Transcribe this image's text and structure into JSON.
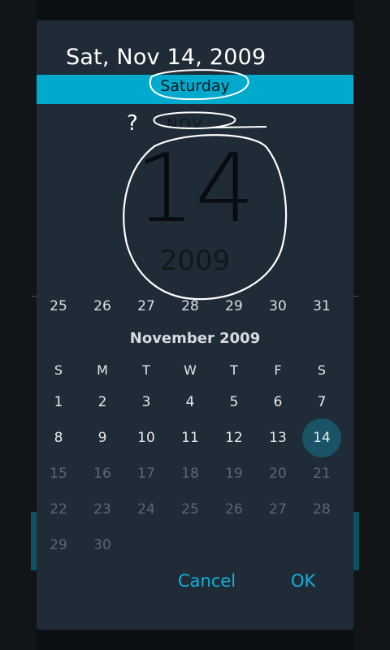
{
  "dialog": {
    "date_title": "Sat, Nov 14, 2009",
    "day_of_week": "Saturday",
    "month_short": "NOV",
    "day_number": "14",
    "year": "2009"
  },
  "calendar": {
    "previous_week": [
      "25",
      "26",
      "27",
      "28",
      "29",
      "30",
      "31"
    ],
    "month_title": "November 2009",
    "weekdays": [
      "S",
      "M",
      "T",
      "W",
      "T",
      "F",
      "S"
    ],
    "weeks": [
      [
        "1",
        "2",
        "3",
        "4",
        "5",
        "6",
        "7"
      ],
      [
        "8",
        "9",
        "10",
        "11",
        "12",
        "13",
        "14"
      ],
      [
        "15",
        "16",
        "17",
        "18",
        "19",
        "20",
        "21"
      ],
      [
        "22",
        "23",
        "24",
        "25",
        "26",
        "27",
        "28"
      ],
      [
        "29",
        "30",
        "",
        "",
        "",
        "",
        ""
      ]
    ],
    "selected_day": "14"
  },
  "buttons": {
    "cancel": "Cancel",
    "ok": "OK"
  },
  "annotation": {
    "question_mark": "?"
  },
  "colors": {
    "accent": "#00aacd",
    "dialog_bg": "#1f2b37",
    "button_text": "#11b1d8",
    "selected_bg": "#1a5366"
  }
}
